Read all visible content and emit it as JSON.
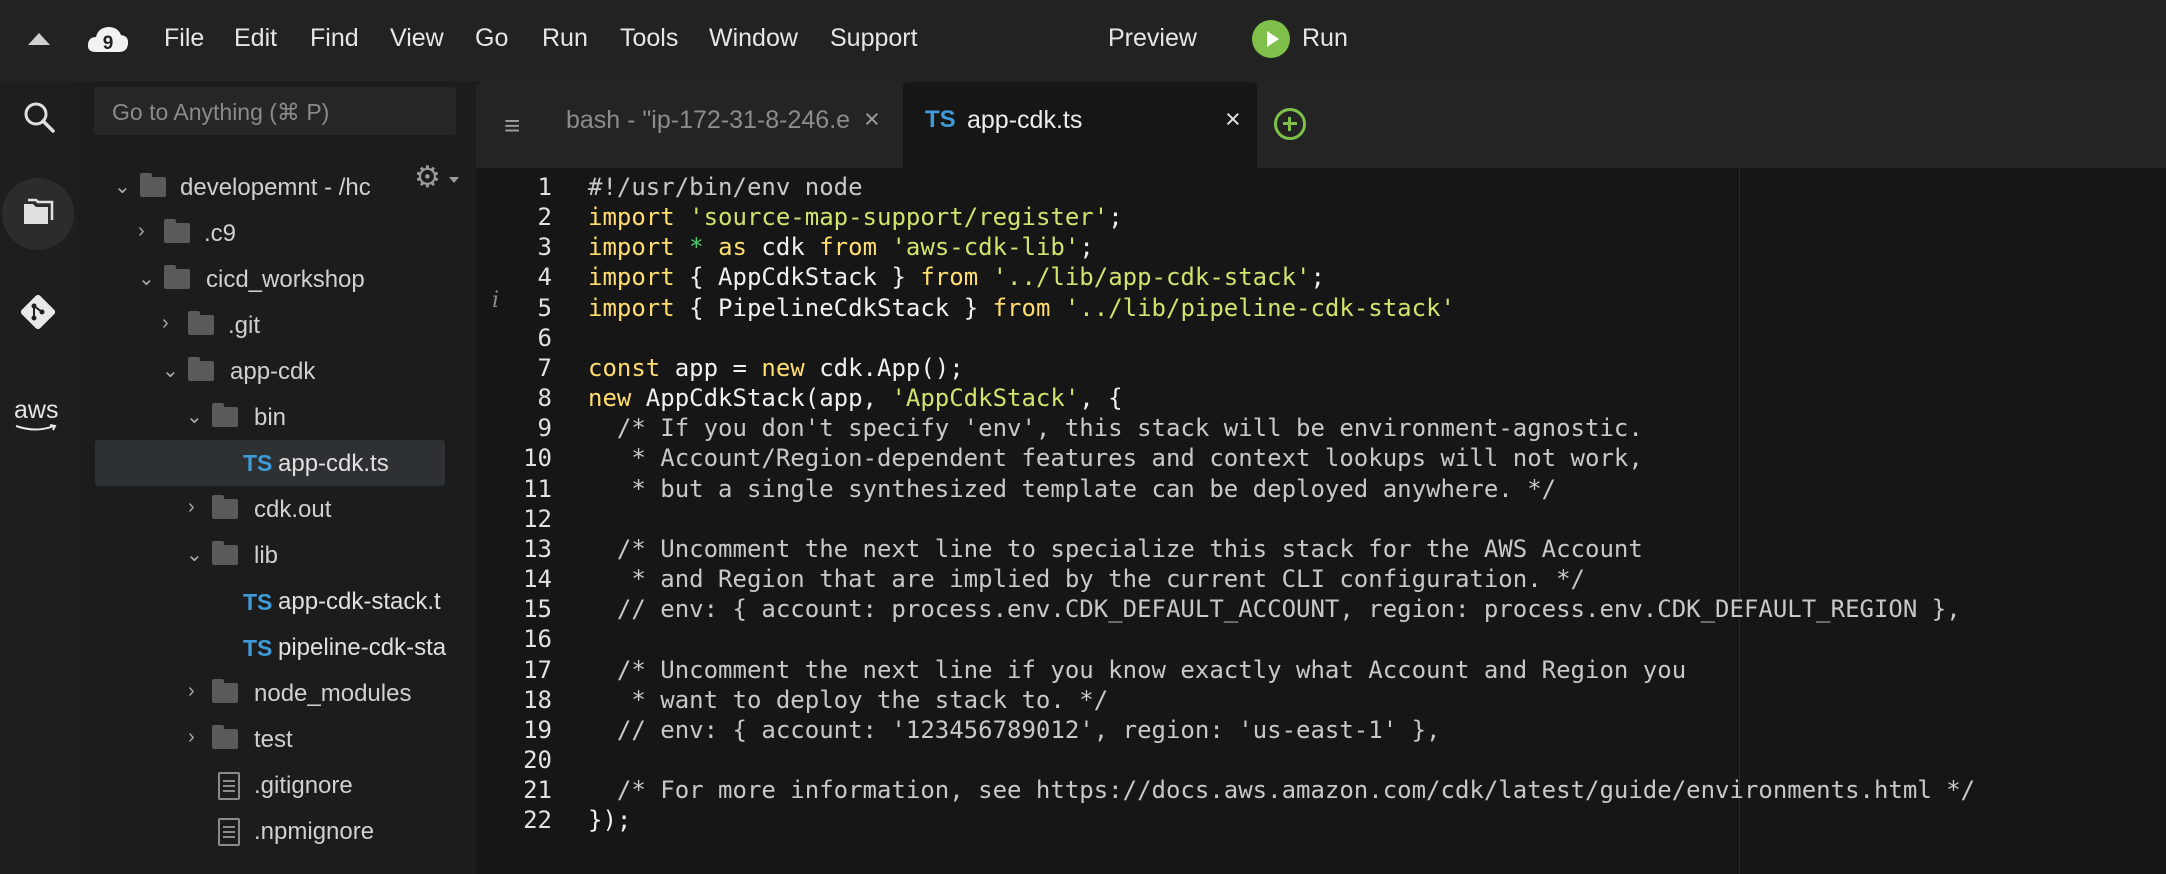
{
  "menu": {
    "items": [
      "File",
      "Edit",
      "Find",
      "View",
      "Go",
      "Run",
      "Tools",
      "Window",
      "Support"
    ],
    "preview": "Preview",
    "run": "Run"
  },
  "rail": {
    "aws_label": "aws"
  },
  "sidebar": {
    "goto_placeholder": "Go to Anything (⌘ P)",
    "tree": [
      {
        "label": "developemnt - /hc",
        "kind": "folder",
        "expanded": true
      },
      {
        "label": ".c9",
        "kind": "folder",
        "expanded": false
      },
      {
        "label": "cicd_workshop",
        "kind": "folder",
        "expanded": true
      },
      {
        "label": ".git",
        "kind": "folder",
        "expanded": false
      },
      {
        "label": "app-cdk",
        "kind": "folder",
        "expanded": true
      },
      {
        "label": "bin",
        "kind": "folder",
        "expanded": true
      },
      {
        "label": "app-cdk.ts",
        "kind": "ts",
        "selected": true
      },
      {
        "label": "cdk.out",
        "kind": "folder",
        "expanded": false
      },
      {
        "label": "lib",
        "kind": "folder",
        "expanded": true
      },
      {
        "label": "app-cdk-stack.t",
        "kind": "ts"
      },
      {
        "label": "pipeline-cdk-sta",
        "kind": "ts"
      },
      {
        "label": "node_modules",
        "kind": "folder",
        "expanded": false
      },
      {
        "label": "test",
        "kind": "folder",
        "expanded": false
      },
      {
        "label": ".gitignore",
        "kind": "file"
      },
      {
        "label": ".npmignore",
        "kind": "file"
      }
    ],
    "ts_badge": "TS"
  },
  "tabs": {
    "bash_label": "bash - \"ip-172-31-8-246.e",
    "active_label": "app-cdk.ts",
    "active_badge": "TS",
    "close_glyph": "×"
  },
  "editor": {
    "line_numbers": [
      "1",
      "2",
      "3",
      "4",
      "5",
      "6",
      "7",
      "8",
      "9",
      "10",
      "11",
      "12",
      "13",
      "14",
      "15",
      "16",
      "17",
      "18",
      "19",
      "20",
      "21",
      "22"
    ],
    "lines": [
      [
        {
          "t": "#!/usr/bin/env node",
          "c": "comment"
        }
      ],
      [
        {
          "t": "import ",
          "c": "kw"
        },
        {
          "t": "'source-map-support/register'",
          "c": "str"
        },
        {
          "t": ";",
          "c": "op"
        }
      ],
      [
        {
          "t": "import ",
          "c": "kw"
        },
        {
          "t": "* ",
          "c": "star"
        },
        {
          "t": "as ",
          "c": "kw"
        },
        {
          "t": "cdk ",
          "c": "op"
        },
        {
          "t": "from ",
          "c": "kw"
        },
        {
          "t": "'aws-cdk-lib'",
          "c": "str"
        },
        {
          "t": ";",
          "c": "op"
        }
      ],
      [
        {
          "t": "import ",
          "c": "kw"
        },
        {
          "t": "{ AppCdkStack } ",
          "c": "op"
        },
        {
          "t": "from ",
          "c": "kw"
        },
        {
          "t": "'../lib/app-cdk-stack'",
          "c": "str"
        },
        {
          "t": ";",
          "c": "op"
        }
      ],
      [
        {
          "t": "import ",
          "c": "kw"
        },
        {
          "t": "{ PipelineCdkStack } ",
          "c": "op"
        },
        {
          "t": "from ",
          "c": "kw"
        },
        {
          "t": "'../lib/pipeline-cdk-stack'",
          "c": "str"
        }
      ],
      [],
      [
        {
          "t": "const ",
          "c": "kw"
        },
        {
          "t": "app = ",
          "c": "op"
        },
        {
          "t": "new ",
          "c": "kw"
        },
        {
          "t": "cdk.App();",
          "c": "op"
        }
      ],
      [
        {
          "t": "new ",
          "c": "kw"
        },
        {
          "t": "AppCdkStack(app, ",
          "c": "op"
        },
        {
          "t": "'AppCdkStack'",
          "c": "str"
        },
        {
          "t": ", {",
          "c": "op"
        }
      ],
      [
        {
          "t": "  /* If you don't specify 'env', this stack will be environment-agnostic.",
          "c": "comment"
        }
      ],
      [
        {
          "t": "   * Account/Region-dependent features and context lookups will not work,",
          "c": "comment"
        }
      ],
      [
        {
          "t": "   * but a single synthesized template can be deployed anywhere. */",
          "c": "comment"
        }
      ],
      [],
      [
        {
          "t": "  /* Uncomment the next line to specialize this stack for the AWS Account",
          "c": "comment"
        }
      ],
      [
        {
          "t": "   * and Region that are implied by the current CLI configuration. */",
          "c": "comment"
        }
      ],
      [
        {
          "t": "  // env: { account: process.env.CDK_DEFAULT_ACCOUNT, region: process.env.CDK_DEFAULT_REGION },",
          "c": "comment"
        }
      ],
      [],
      [
        {
          "t": "  /* Uncomment the next line if you know exactly what Account and Region you",
          "c": "comment"
        }
      ],
      [
        {
          "t": "   * want to deploy the stack to. */",
          "c": "comment"
        }
      ],
      [
        {
          "t": "  // env: { account: '123456789012', region: 'us-east-1' },",
          "c": "comment"
        }
      ],
      [],
      [
        {
          "t": "  /* For more information, see https://docs.aws.amazon.com/cdk/latest/guide/environments.html */",
          "c": "comment"
        }
      ],
      [
        {
          "t": "});",
          "c": "op"
        }
      ]
    ]
  },
  "colors": {
    "accent_green": "#7fc04a",
    "ts_blue": "#3f9bd8",
    "keyword": "#ffdd6e",
    "string": "#d2e26c"
  },
  "icons": [
    "collapse-caret-icon",
    "cloud9-logo-icon",
    "search-icon",
    "files-icon",
    "git-icon",
    "aws-icon",
    "gear-icon",
    "hamburger-menu-icon",
    "add-tab-icon",
    "play-icon"
  ]
}
